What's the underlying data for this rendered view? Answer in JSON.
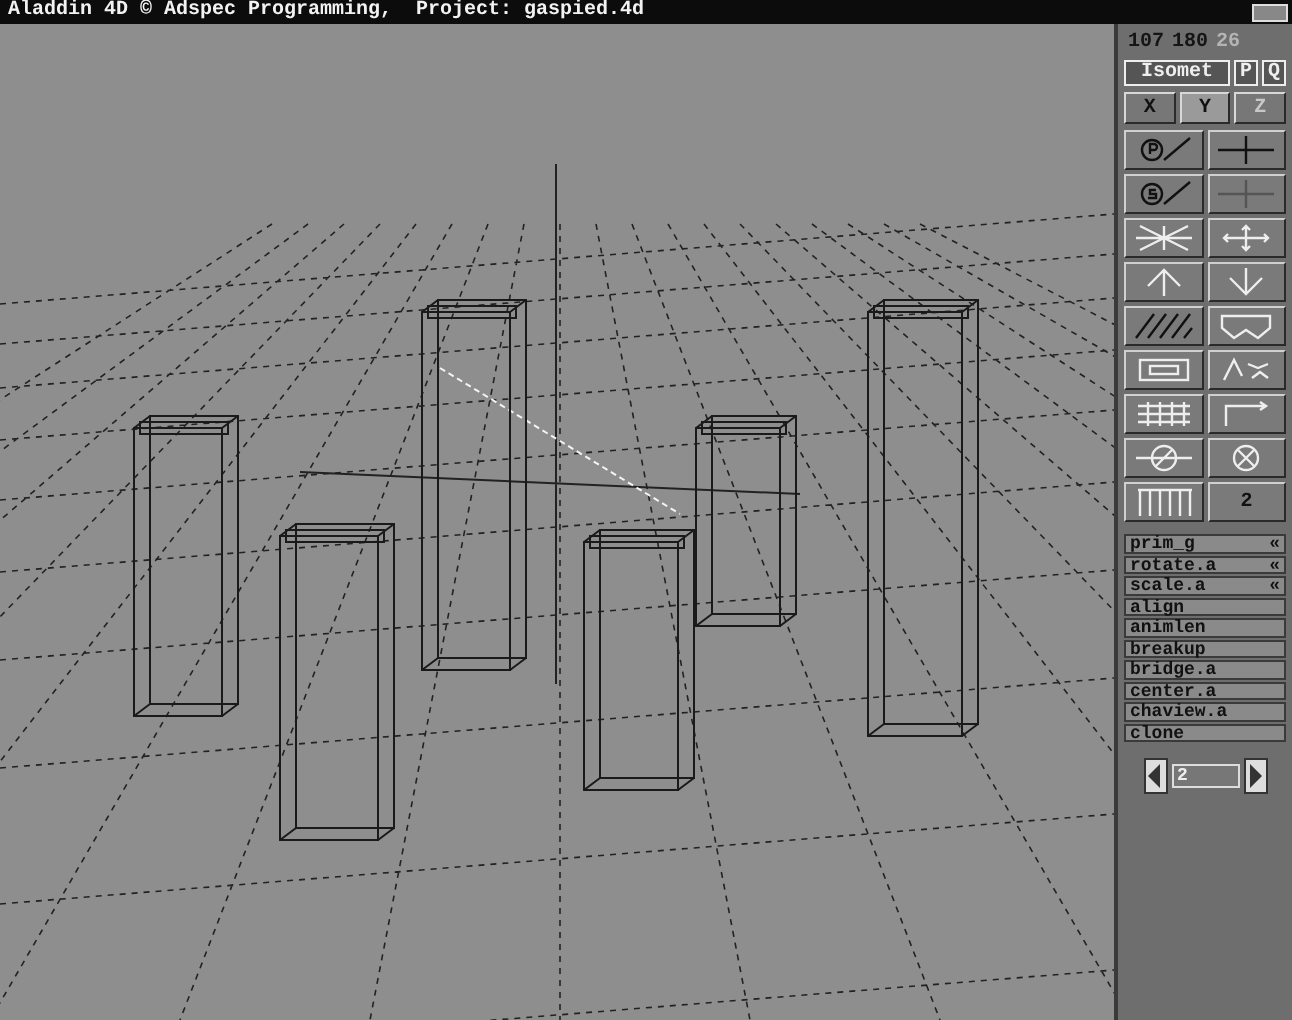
{
  "window": {
    "title": "Aladdin 4D © Adspec Programming,  Project: gaspied.4d"
  },
  "coords": [
    {
      "value": "107",
      "dim": false
    },
    {
      "value": "180",
      "dim": false
    },
    {
      "value": "26",
      "dim": true
    }
  ],
  "view_buttons": [
    {
      "label": "Isomet"
    },
    {
      "label": "P"
    },
    {
      "label": "Q"
    }
  ],
  "axes": [
    {
      "label": "X",
      "selected": false,
      "disabled": false
    },
    {
      "label": "Y",
      "selected": true,
      "disabled": false
    },
    {
      "label": "Z",
      "selected": false,
      "disabled": true
    }
  ],
  "tools": [
    {
      "kind": "circle-p"
    },
    {
      "kind": "crosshair"
    },
    {
      "kind": "circle-s"
    },
    {
      "kind": "blank"
    },
    {
      "kind": "burst"
    },
    {
      "kind": "move"
    },
    {
      "kind": "arrow-up"
    },
    {
      "kind": "arrow-down"
    },
    {
      "kind": "hatch"
    },
    {
      "kind": "goggles"
    },
    {
      "kind": "frame"
    },
    {
      "kind": "scatter"
    },
    {
      "kind": "grid"
    },
    {
      "kind": "corner"
    },
    {
      "kind": "wheel"
    },
    {
      "kind": "null"
    },
    {
      "kind": "bars"
    },
    {
      "kind": "text",
      "label": "2"
    }
  ],
  "scripts": [
    {
      "name": "prim_g",
      "marker": "«"
    },
    {
      "name": "rotate.a",
      "marker": "«"
    },
    {
      "name": "scale.a",
      "marker": "«"
    },
    {
      "name": "align"
    },
    {
      "name": "animlen"
    },
    {
      "name": "breakup"
    },
    {
      "name": "bridge.a"
    },
    {
      "name": "center.a"
    },
    {
      "name": "chaview.a"
    },
    {
      "name": "clone"
    }
  ],
  "counter": {
    "value": "2"
  }
}
